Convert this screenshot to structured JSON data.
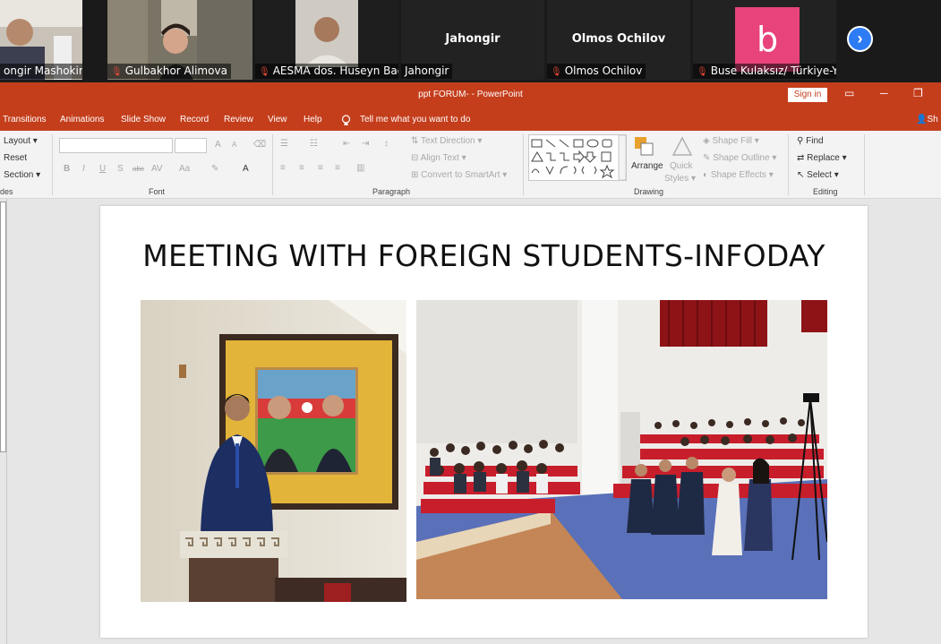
{
  "participants": [
    {
      "name": "ongir Mashokirov",
      "muted": false
    },
    {
      "name": "Gulbakhor Alimova",
      "muted": true
    },
    {
      "name": "AESMA dos. Huseyn Bag...",
      "muted": true
    },
    {
      "name": "Jahongir",
      "big_name": "Jahongir",
      "muted": false
    },
    {
      "name": "Olmos Ochilov",
      "big_name": "Olmos Ochilov",
      "muted": true
    },
    {
      "name": "Buse Kulaksız/ Türkiye-Y...",
      "avatar_letter": "b",
      "muted": true
    }
  ],
  "app": {
    "doc_title": "ppt FORUM-  -  PowerPoint",
    "sign_in": "Sign in",
    "share": "Sh"
  },
  "tabs": [
    "Transitions",
    "Animations",
    "Slide Show",
    "Record",
    "Review",
    "View",
    "Help"
  ],
  "tell_me": "Tell me what you want to do",
  "ribbon": {
    "slides": {
      "layout": "Layout",
      "reset": "Reset",
      "section": "Section",
      "group": "des"
    },
    "font": {
      "bold": "B",
      "italic": "I",
      "underline": "U",
      "strike": "S",
      "strike2": "abc",
      "spacing": "AV",
      "case": "Aa",
      "grow": "A",
      "shrink": "A",
      "color": "A",
      "group": "Font"
    },
    "paragraph": {
      "text_direction": "Text Direction",
      "align_text": "Align Text",
      "smartart": "Convert to SmartArt",
      "group": "Paragraph"
    },
    "drawing": {
      "arrange": "Arrange",
      "quick_styles_1": "Quick",
      "quick_styles_2": "Styles",
      "shape_fill": "Shape Fill",
      "shape_outline": "Shape Outline",
      "shape_effects": "Shape Effects",
      "group": "Drawing"
    },
    "editing": {
      "find": "Find",
      "replace": "Replace",
      "select": "Select",
      "group": "Editing"
    }
  },
  "slide": {
    "title": "MEETING WITH FOREIGN STUDENTS-INFODAY"
  },
  "colors": {
    "powerpoint_red": "#c43e1c",
    "zoom_blue": "#2d7cf6",
    "avatar_pink": "#e8437b"
  }
}
